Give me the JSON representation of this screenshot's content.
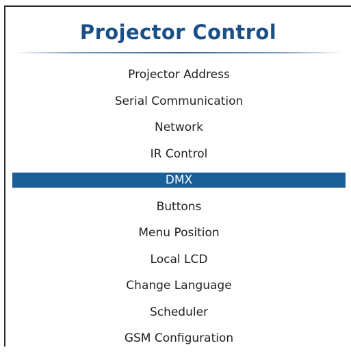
{
  "panel": {
    "title": "Projector Control",
    "selected_index": 4,
    "items": [
      {
        "label": "Projector Address"
      },
      {
        "label": "Serial Communication"
      },
      {
        "label": "Network"
      },
      {
        "label": "IR Control"
      },
      {
        "label": "DMX"
      },
      {
        "label": "Buttons"
      },
      {
        "label": "Menu Position"
      },
      {
        "label": "Local LCD"
      },
      {
        "label": "Change Language"
      },
      {
        "label": "Scheduler"
      },
      {
        "label": "GSM Configuration"
      }
    ]
  },
  "colors": {
    "title": "#1b4f86",
    "selection_background": "#1b5f99",
    "selection_text": "#ffffff",
    "item_text": "#1f1f1f"
  }
}
